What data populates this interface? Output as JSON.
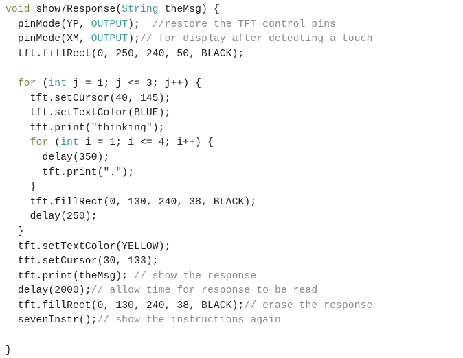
{
  "editor": {
    "language": "arduino-cpp",
    "background": "#ffffff",
    "palette": {
      "plain": "#222222",
      "keyword": "#7d8c4a",
      "type": "#3f9a9a",
      "function": "#d4915d",
      "comment": "#8a8a8a",
      "string": "#2e2e2e",
      "number": "#222222"
    }
  },
  "lines": [
    {
      "index": 0,
      "tokens": [
        {
          "text": "void",
          "kind": "keyword"
        },
        {
          "text": " show7Response(",
          "kind": "plain"
        },
        {
          "text": "String",
          "kind": "type"
        },
        {
          "text": " theMsg) {",
          "kind": "plain"
        }
      ]
    },
    {
      "index": 1,
      "tokens": [
        {
          "text": "  ",
          "kind": "plain"
        },
        {
          "text": "pinMode",
          "kind": "function"
        },
        {
          "text": "(YP, ",
          "kind": "plain"
        },
        {
          "text": "OUTPUT",
          "kind": "type"
        },
        {
          "text": ");  ",
          "kind": "plain"
        },
        {
          "text": "//restore the TFT control pins",
          "kind": "comment"
        }
      ]
    },
    {
      "index": 2,
      "tokens": [
        {
          "text": "  ",
          "kind": "plain"
        },
        {
          "text": "pinMode",
          "kind": "function"
        },
        {
          "text": "(XM, ",
          "kind": "plain"
        },
        {
          "text": "OUTPUT",
          "kind": "type"
        },
        {
          "text": ");",
          "kind": "plain"
        },
        {
          "text": "// for display after detecting a touch",
          "kind": "comment"
        }
      ]
    },
    {
      "index": 3,
      "tokens": [
        {
          "text": "  tft.",
          "kind": "plain"
        },
        {
          "text": "fillRect",
          "kind": "function"
        },
        {
          "text": "(0, 250, 240, 50, BLACK);",
          "kind": "plain"
        }
      ]
    },
    {
      "index": 4,
      "tokens": [
        {
          "text": "",
          "kind": "plain"
        }
      ]
    },
    {
      "index": 5,
      "tokens": [
        {
          "text": "  ",
          "kind": "plain"
        },
        {
          "text": "for",
          "kind": "keyword"
        },
        {
          "text": " (",
          "kind": "plain"
        },
        {
          "text": "int",
          "kind": "type"
        },
        {
          "text": " j = 1; j <= 3; j++) {",
          "kind": "plain"
        }
      ]
    },
    {
      "index": 6,
      "tokens": [
        {
          "text": "    tft.",
          "kind": "plain"
        },
        {
          "text": "setCursor",
          "kind": "function"
        },
        {
          "text": "(40, 145);",
          "kind": "plain"
        }
      ]
    },
    {
      "index": 7,
      "tokens": [
        {
          "text": "    tft.",
          "kind": "plain"
        },
        {
          "text": "setTextColor",
          "kind": "function"
        },
        {
          "text": "(BLUE);",
          "kind": "plain"
        }
      ]
    },
    {
      "index": 8,
      "tokens": [
        {
          "text": "    tft.",
          "kind": "plain"
        },
        {
          "text": "print",
          "kind": "function"
        },
        {
          "text": "(",
          "kind": "plain"
        },
        {
          "text": "\"thinking\"",
          "kind": "string"
        },
        {
          "text": ");",
          "kind": "plain"
        }
      ]
    },
    {
      "index": 9,
      "tokens": [
        {
          "text": "    ",
          "kind": "plain"
        },
        {
          "text": "for",
          "kind": "keyword"
        },
        {
          "text": " (",
          "kind": "plain"
        },
        {
          "text": "int",
          "kind": "type"
        },
        {
          "text": " i = 1; i <= 4; i++) {",
          "kind": "plain"
        }
      ]
    },
    {
      "index": 10,
      "tokens": [
        {
          "text": "      ",
          "kind": "plain"
        },
        {
          "text": "delay",
          "kind": "function"
        },
        {
          "text": "(350);",
          "kind": "plain"
        }
      ]
    },
    {
      "index": 11,
      "tokens": [
        {
          "text": "      tft.",
          "kind": "plain"
        },
        {
          "text": "print",
          "kind": "function"
        },
        {
          "text": "(",
          "kind": "plain"
        },
        {
          "text": "\".\"",
          "kind": "string"
        },
        {
          "text": ");",
          "kind": "plain"
        }
      ]
    },
    {
      "index": 12,
      "tokens": [
        {
          "text": "    }",
          "kind": "plain"
        }
      ]
    },
    {
      "index": 13,
      "tokens": [
        {
          "text": "    tft.",
          "kind": "plain"
        },
        {
          "text": "fillRect",
          "kind": "function"
        },
        {
          "text": "(0, 130, 240, 38, BLACK);",
          "kind": "plain"
        }
      ]
    },
    {
      "index": 14,
      "tokens": [
        {
          "text": "    ",
          "kind": "plain"
        },
        {
          "text": "delay",
          "kind": "function"
        },
        {
          "text": "(250);",
          "kind": "plain"
        }
      ]
    },
    {
      "index": 15,
      "tokens": [
        {
          "text": "  }",
          "kind": "plain"
        }
      ]
    },
    {
      "index": 16,
      "tokens": [
        {
          "text": "  tft.",
          "kind": "plain"
        },
        {
          "text": "setTextColor",
          "kind": "function"
        },
        {
          "text": "(YELLOW);",
          "kind": "plain"
        }
      ]
    },
    {
      "index": 17,
      "tokens": [
        {
          "text": "  tft.",
          "kind": "plain"
        },
        {
          "text": "setCursor",
          "kind": "function"
        },
        {
          "text": "(30, 133);",
          "kind": "plain"
        }
      ]
    },
    {
      "index": 18,
      "tokens": [
        {
          "text": "  tft.",
          "kind": "plain"
        },
        {
          "text": "print",
          "kind": "function"
        },
        {
          "text": "(theMsg); ",
          "kind": "plain"
        },
        {
          "text": "// show the response",
          "kind": "comment"
        }
      ]
    },
    {
      "index": 19,
      "tokens": [
        {
          "text": "  ",
          "kind": "plain"
        },
        {
          "text": "delay",
          "kind": "function"
        },
        {
          "text": "(2000);",
          "kind": "plain"
        },
        {
          "text": "// allow time for response to be read",
          "kind": "comment"
        }
      ]
    },
    {
      "index": 20,
      "tokens": [
        {
          "text": "  tft.",
          "kind": "plain"
        },
        {
          "text": "fillRect",
          "kind": "function"
        },
        {
          "text": "(0, 130, 240, 38, BLACK);",
          "kind": "plain"
        },
        {
          "text": "// erase the response",
          "kind": "comment"
        }
      ]
    },
    {
      "index": 21,
      "tokens": [
        {
          "text": "  sevenInstr();",
          "kind": "plain"
        },
        {
          "text": "// show the instructions again",
          "kind": "comment"
        }
      ]
    },
    {
      "index": 22,
      "tokens": [
        {
          "text": "",
          "kind": "plain"
        }
      ]
    },
    {
      "index": 23,
      "tokens": [
        {
          "text": "}",
          "kind": "plain"
        }
      ]
    }
  ]
}
